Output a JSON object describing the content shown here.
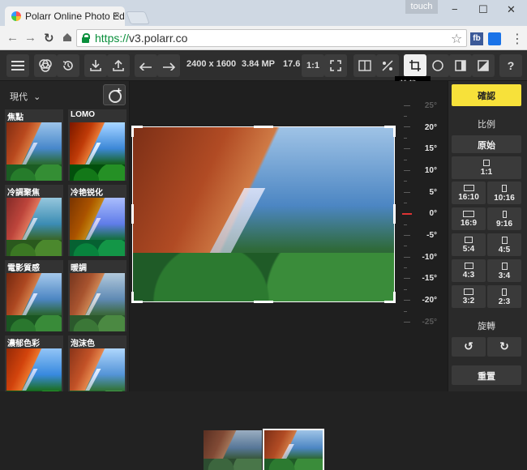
{
  "browser": {
    "tab_title": "Polarr Online Photo Edito",
    "tab_close": "×",
    "touch_label": "touch",
    "url_scheme": "https://",
    "url_host": "v3.polarr.co",
    "ext_fb": "fb",
    "window_controls": {
      "minimize": "−",
      "maximize": "☐",
      "close": "✕"
    },
    "nav_icons": {
      "back": "←",
      "forward": "→",
      "reload": "↻",
      "star": "☆",
      "menu": "⋮"
    }
  },
  "toolbar": {
    "dimensions": "2400 x 1600",
    "megapixels": "3.84 MP",
    "zoom_partial": "17.6",
    "zoom_1to1": "1:1",
    "tooltip": "剪裁",
    "tooltip_key": "R",
    "help": "?",
    "icons": [
      "menu-icon",
      "filter-icon",
      "history-icon",
      "import-icon",
      "export-icon",
      "undo-icon",
      "redo-icon",
      "fullscreen-icon",
      "compare-icon",
      "adjust-icon",
      "crop-icon",
      "circle-mask-icon",
      "square-icon",
      "gradient-icon",
      "help-icon"
    ]
  },
  "left_panel": {
    "header": "現代",
    "header_arrow": "⌄",
    "presets": [
      "焦點",
      "LOMO",
      "冷調聚焦",
      "冷艳锐化",
      "電影質感",
      "暖調",
      "濃郁色彩",
      "泡沫色"
    ]
  },
  "dial": {
    "labels": [
      "25°",
      "20°",
      "15°",
      "10°",
      "5°",
      "0°",
      "-5°",
      "-10°",
      "-15°",
      "-20°",
      "-25°"
    ],
    "dim_labels": [
      "25°",
      "-25°"
    ]
  },
  "right_panel": {
    "confirm": "確認",
    "ratio_title": "比例",
    "original": "原始",
    "ratios": [
      "1:1",
      "16:10",
      "10:16",
      "16:9",
      "9:16",
      "5:4",
      "4:5",
      "4:3",
      "3:4",
      "3:2",
      "2:3"
    ],
    "rotate_title": "旋轉",
    "rotate_left": "↺",
    "rotate_right": "↻",
    "reset": "重置"
  },
  "colors": {
    "accent": "#f7e13a",
    "url_green": "#0a8f3c",
    "zero_marker": "#dd3333"
  }
}
